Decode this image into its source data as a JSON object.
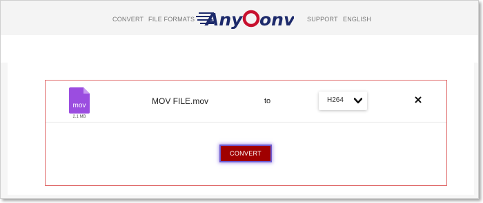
{
  "header": {
    "nav": [
      {
        "label": "CONVERT"
      },
      {
        "label": "FILE FORMATS"
      },
      {
        "label": "SUPPORT"
      },
      {
        "label": "ENGLISH"
      }
    ],
    "logo": {
      "text": "AnyConv"
    }
  },
  "converter": {
    "file": {
      "icon": "file-icon",
      "extension": "mov",
      "size": "2.1 MB",
      "name": "MOV FILE.mov"
    },
    "to_label": "to",
    "target_format": {
      "selected": "H264"
    },
    "convert_label": "CONVERT"
  },
  "colors": {
    "accent": "#a00000",
    "file_icon": "#9b4de0",
    "convert_focus_ring": "#6d5bd0",
    "logo_blue": "#1d2a6b",
    "logo_red": "#c8102e",
    "border": "#e06a6a"
  }
}
